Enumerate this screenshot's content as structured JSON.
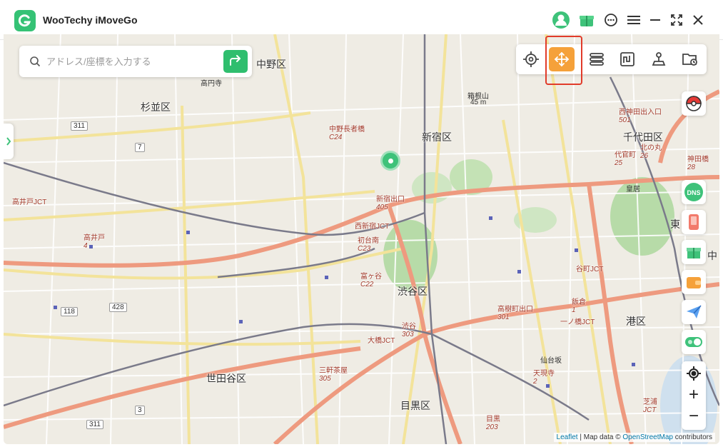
{
  "app": {
    "title": "WooTechy iMoveGo"
  },
  "search": {
    "placeholder": "アドレス/座標を入力する",
    "value": ""
  },
  "map": {
    "wards": [
      "中野区",
      "杉並区",
      "新宿区",
      "千代田区",
      "渋谷区",
      "港区",
      "世田谷区",
      "目黒区",
      "東",
      "中"
    ],
    "stations": [
      {
        "name": "中野長者橋",
        "code": "C24"
      },
      {
        "name": "新宿出口",
        "code": "405"
      },
      {
        "name": "西新宿JCT",
        "code": ""
      },
      {
        "name": "初台南",
        "code": "C23"
      },
      {
        "name": "富ヶ谷",
        "code": "C22"
      },
      {
        "name": "渋谷",
        "code": "303"
      },
      {
        "name": "高樹町出口",
        "code": "301"
      },
      {
        "name": "大橋JCT",
        "code": ""
      },
      {
        "name": "三軒茶屋",
        "code": "305"
      },
      {
        "name": "高井戸",
        "code": "4"
      },
      {
        "name": "高井戸JCT",
        "code": ""
      },
      {
        "name": "西神田出入口",
        "code": "501"
      },
      {
        "name": "代官町",
        "code": "25"
      },
      {
        "name": "北の丸",
        "code": "26"
      },
      {
        "name": "神田橋",
        "code": "28"
      },
      {
        "name": "谷町JCT",
        "code": ""
      },
      {
        "name": "飯倉",
        "code": "1"
      },
      {
        "name": "一ノ橋JCT",
        "code": ""
      },
      {
        "name": "天現寺",
        "code": "2"
      },
      {
        "name": "目黒",
        "code": "203"
      },
      {
        "name": "芝浦",
        "code": "JCT"
      }
    ],
    "places": [
      "箱根山",
      "45 m",
      "皇居",
      "仙台坂",
      "高円寺"
    ],
    "road_numbers": [
      "311",
      "7",
      "118",
      "428",
      "3",
      "311"
    ]
  },
  "attribution": {
    "leaflet": "Leaflet",
    "sep": " | Map data © ",
    "osm": "OpenStreetMap",
    "tail": " contributors"
  },
  "colors": {
    "accent": "#2fbe6e",
    "mode_active": "#f5a13a",
    "highlight": "#e13b2a"
  },
  "icons": [
    "app-logo-icon",
    "avatar-icon",
    "gift-icon",
    "chat-icon",
    "menu-icon",
    "minimize-icon",
    "expand-icon",
    "close-icon",
    "search-icon",
    "route-arrow-icon",
    "target-icon",
    "joystick-move-icon",
    "multi-route-icon",
    "jump-icon",
    "teleport-icon",
    "history-icon",
    "pokeball-icon",
    "dns-icon",
    "device-icon",
    "gift-box-icon",
    "wallet-icon",
    "send-icon",
    "toggle-icon",
    "locate-icon"
  ]
}
